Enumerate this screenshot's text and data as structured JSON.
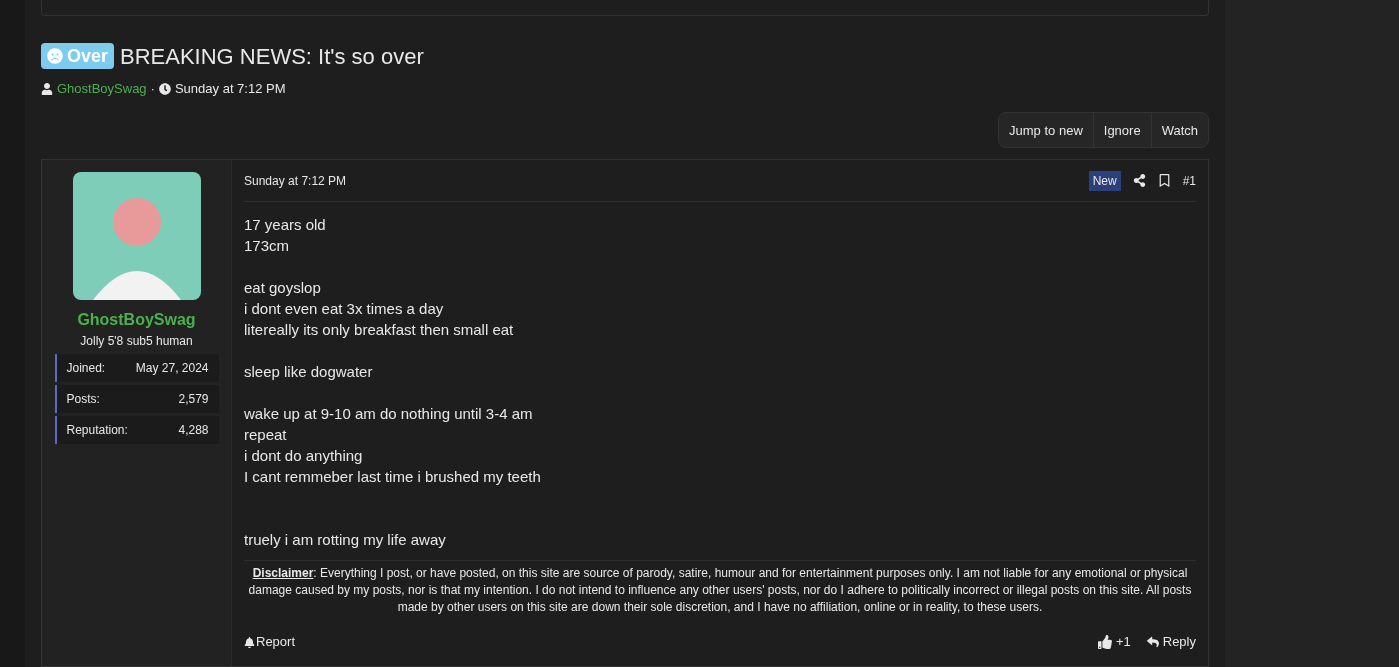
{
  "thread": {
    "prefix": {
      "label": "Over",
      "color": "#7ecbf0"
    },
    "title": "BREAKING NEWS: It's so over",
    "author": "GhostBoySwag",
    "separator": "·",
    "date": "Sunday at 7:12 PM"
  },
  "actions": [
    "Jump to new",
    "Ignore",
    "Watch"
  ],
  "post": {
    "user": {
      "name": "GhostBoySwag",
      "title": "Jolly 5'8 sub5 human",
      "stats": [
        {
          "label": "Joined:",
          "value": "May 27, 2024"
        },
        {
          "label": "Posts:",
          "value": "2,579"
        },
        {
          "label": "Reputation:",
          "value": "4,288"
        }
      ]
    },
    "date": "Sunday at 7:12 PM",
    "new_badge": "New",
    "number": "#1",
    "paragraphs": [
      {
        "wide_gap": false,
        "lines": [
          "17 years old",
          "173cm"
        ]
      },
      {
        "wide_gap": false,
        "lines": [
          "eat goyslop",
          "i dont even eat 3x times a day",
          "litereally its only breakfast then small eat"
        ]
      },
      {
        "wide_gap": false,
        "lines": [
          "sleep like dogwater"
        ]
      },
      {
        "wide_gap": false,
        "lines": [
          "wake up at 9-10 am do nothing until 3-4 am",
          "repeat",
          "i dont do anything",
          "I cant remmeber last time i brushed my teeth"
        ]
      },
      {
        "wide_gap": true,
        "lines": [
          "truely i am rotting my life away"
        ]
      }
    ],
    "signature": "**Disclaimer**: Everything I post, or have posted, on this site are source of parody, satire, humour and for entertainment purposes only. I am not liable for any emotional or physical damage caused by my posts, nor is that my intention. I do not intend to influence any other users' posts, nor do I adhere to politically incorrect or illegal posts on this site. All posts made by other users on this site are down their sole discretion, and I have no affiliation, online or in reality, to these users.",
    "report": "Report",
    "likes": "+1",
    "reply": "Reply"
  }
}
